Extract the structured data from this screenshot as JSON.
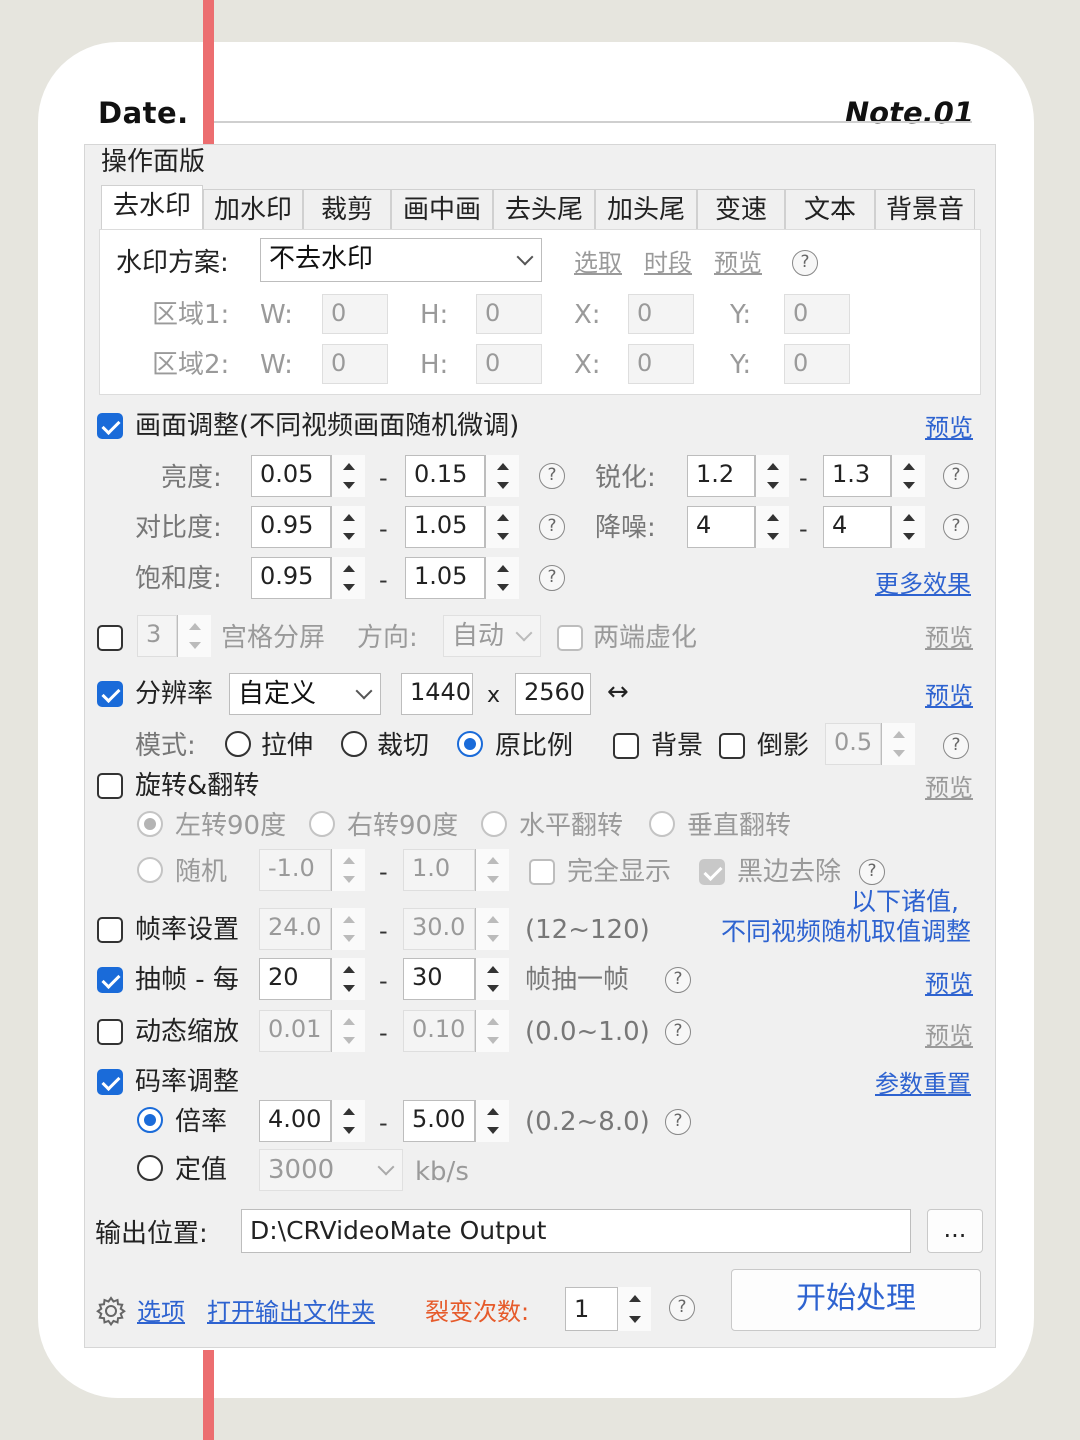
{
  "header": {
    "left": "Date.",
    "right": "Note.01"
  },
  "panel_title": "操作面版",
  "tabs": [
    "去水印",
    "加水印",
    "裁剪",
    "画中画",
    "去头尾",
    "加头尾",
    "变速",
    "文本",
    "背景音"
  ],
  "watermark": {
    "scheme_label": "水印方案:",
    "scheme_value": "不去水印",
    "links": {
      "select": "选取",
      "period": "时段",
      "preview": "预览"
    },
    "region1": {
      "label": "区域1:",
      "w_label": "W:",
      "w": "0",
      "h_label": "H:",
      "h": "0",
      "x_label": "X:",
      "x": "0",
      "y_label": "Y:",
      "y": "0"
    },
    "region2": {
      "label": "区域2:",
      "w_label": "W:",
      "w": "0",
      "h_label": "H:",
      "h": "0",
      "x_label": "X:",
      "x": "0",
      "y_label": "Y:",
      "y": "0"
    }
  },
  "adjust": {
    "label": "画面调整(不同视频画面随机微调)",
    "preview": "预览",
    "brightness": {
      "label": "亮度:",
      "min": "0.05",
      "max": "0.15"
    },
    "contrast": {
      "label": "对比度:",
      "min": "0.95",
      "max": "1.05"
    },
    "saturation": {
      "label": "饱和度:",
      "min": "0.95",
      "max": "1.05"
    },
    "sharpen": {
      "label": "锐化:",
      "min": "1.2",
      "max": "1.3"
    },
    "denoise": {
      "label": "降噪:",
      "min": "4",
      "max": "4"
    },
    "more": "更多效果"
  },
  "grid": {
    "count": "3",
    "label": "宫格分屏",
    "dir_label": "方向:",
    "dir_value": "自动",
    "blur_label": "两端虚化",
    "preview": "预览"
  },
  "resolution": {
    "label": "分辨率",
    "preset": "自定义",
    "width": "1440",
    "x": "x",
    "height": "2560",
    "swap": "↔",
    "preview": "预览",
    "mode_label": "模式:",
    "modes": [
      "拉伸",
      "裁切",
      "原比例"
    ],
    "bg_label": "背景",
    "reflect_label": "倒影",
    "reflect_value": "0.5"
  },
  "rotate": {
    "label": "旋转&翻转",
    "preview": "预览",
    "options": [
      "左转90度",
      "右转90度",
      "水平翻转",
      "垂直翻转"
    ],
    "random_label": "随机",
    "rand_min": "-1.0",
    "rand_max": "1.0",
    "full_label": "完全显示",
    "black_label": "黑边去除"
  },
  "note": {
    "line1": "以下诸值,",
    "line2": "不同视频随机取值调整"
  },
  "framerate": {
    "label": "帧率设置",
    "min": "24.0",
    "max": "30.0",
    "range": "(12~120)"
  },
  "framedrop": {
    "label": "抽帧 - 每",
    "min": "20",
    "max": "30",
    "suffix": "帧抽一帧",
    "preview": "预览"
  },
  "zoom": {
    "label": "动态缩放",
    "min": "0.01",
    "max": "0.10",
    "range": "(0.0~1.0)",
    "preview": "预览"
  },
  "bitrate": {
    "label": "码率调整",
    "reset": "参数重置",
    "ratio_label": "倍率",
    "ratio_min": "4.00",
    "ratio_max": "5.00",
    "ratio_range": "(0.2~8.0)",
    "fixed_label": "定值",
    "fixed_value": "3000",
    "unit": "kb/s"
  },
  "output": {
    "label": "输出位置:",
    "path": "D:\\CRVideoMate Output",
    "browse": "..."
  },
  "footer": {
    "options": "选项",
    "open_folder": "打开输出文件夹",
    "fission_label": "裂变次数:",
    "fission_value": "1",
    "start": "开始处理"
  },
  "help_glyph": "?",
  "dash": "-",
  "colors": {
    "accent": "#1a6bd9",
    "link": "#2e63d0",
    "redline": "#ec6e70",
    "orange": "#e65a2a"
  }
}
